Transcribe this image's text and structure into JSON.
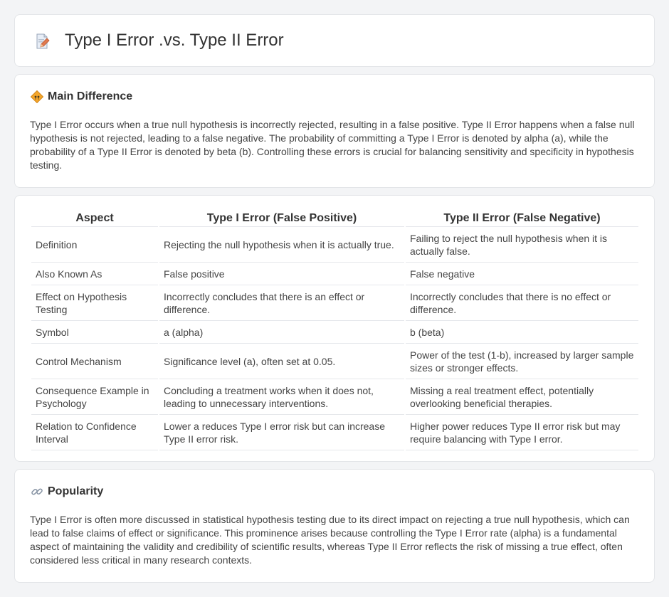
{
  "header": {
    "title": "Type I Error .vs. Type II Error",
    "icon": "document-edit-icon"
  },
  "main_difference": {
    "title": "Main Difference",
    "icon": "diamond-sign-icon",
    "text": "Type I Error occurs when a true null hypothesis is incorrectly rejected, resulting in a false positive. Type II Error happens when a false null hypothesis is not rejected, leading to a false negative. The probability of committing a Type I Error is denoted by alpha (a), while the probability of a Type II Error is denoted by beta (b). Controlling these errors is crucial for balancing sensitivity and specificity in hypothesis testing."
  },
  "table": {
    "headers": [
      "Aspect",
      "Type I Error (False Positive)",
      "Type II Error (False Negative)"
    ],
    "rows": [
      [
        "Definition",
        "Rejecting the null hypothesis when it is actually true.",
        "Failing to reject the null hypothesis when it is actually false."
      ],
      [
        "Also Known As",
        "False positive",
        "False negative"
      ],
      [
        "Effect on Hypothesis Testing",
        "Incorrectly concludes that there is an effect or difference.",
        "Incorrectly concludes that there is no effect or difference."
      ],
      [
        "Symbol",
        "a (alpha)",
        "b (beta)"
      ],
      [
        "Control Mechanism",
        "Significance level (a), often set at 0.05.",
        "Power of the test (1-b), increased by larger sample sizes or stronger effects."
      ],
      [
        "Consequence Example in Psychology",
        "Concluding a treatment works when it does not, leading to unnecessary interventions.",
        "Missing a real treatment effect, potentially overlooking beneficial therapies."
      ],
      [
        "Relation to Confidence Interval",
        "Lower a reduces Type I error risk but can increase Type II error risk.",
        "Higher power reduces Type II error risk but may require balancing with Type I error."
      ]
    ]
  },
  "popularity": {
    "title": "Popularity",
    "icon": "link-icon",
    "text": "Type I Error is often more discussed in statistical hypothesis testing due to its direct impact on rejecting a true null hypothesis, which can lead to false claims of effect or significance. This prominence arises because controlling the Type I Error rate (alpha) is a fundamental aspect of maintaining the validity and credibility of scientific results, whereas Type II Error reflects the risk of missing a true effect, often considered less critical in many research contexts."
  }
}
